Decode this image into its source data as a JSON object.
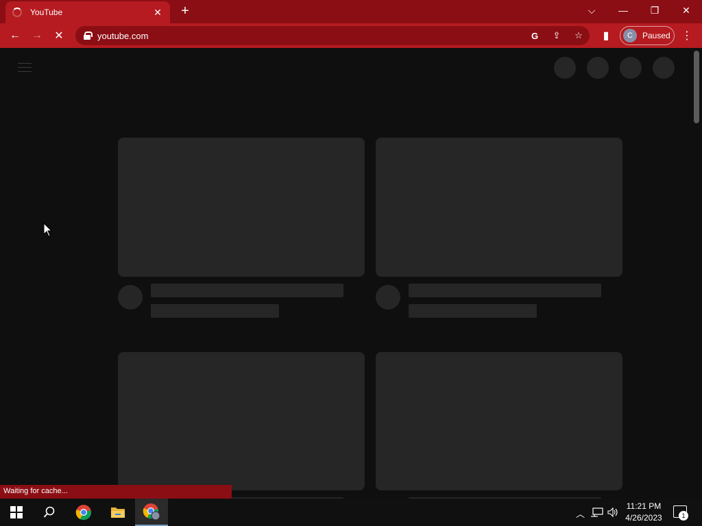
{
  "browser": {
    "tab": {
      "title": "YouTube",
      "close_label": "✕",
      "icon": "loading-spinner-icon"
    },
    "new_tab_label": "+",
    "window_controls": {
      "tab_search": "⌵",
      "minimize": "—",
      "restore": "❐",
      "close": "✕"
    },
    "toolbar": {
      "back_label": "←",
      "forward_label": "→",
      "stop_label": "✕",
      "url": "youtube.com",
      "google_icon_label": "G",
      "share_label": "⇪",
      "bookmark_label": "☆",
      "sidepanel_label": "▮",
      "profile": {
        "initial": "C",
        "label": "Paused"
      },
      "menu_label": "⋮"
    },
    "accent": "#b51b20",
    "accent_dark": "#8b0e14"
  },
  "status_bar": {
    "text": "Waiting for cache..."
  },
  "taskbar": {
    "clock": {
      "time": "11:21 PM",
      "date": "4/26/2023"
    },
    "notification_count": "1",
    "items": [
      "start-icon",
      "search-icon",
      "chrome-icon",
      "file-explorer-icon",
      "chrome-profile-icon"
    ]
  }
}
